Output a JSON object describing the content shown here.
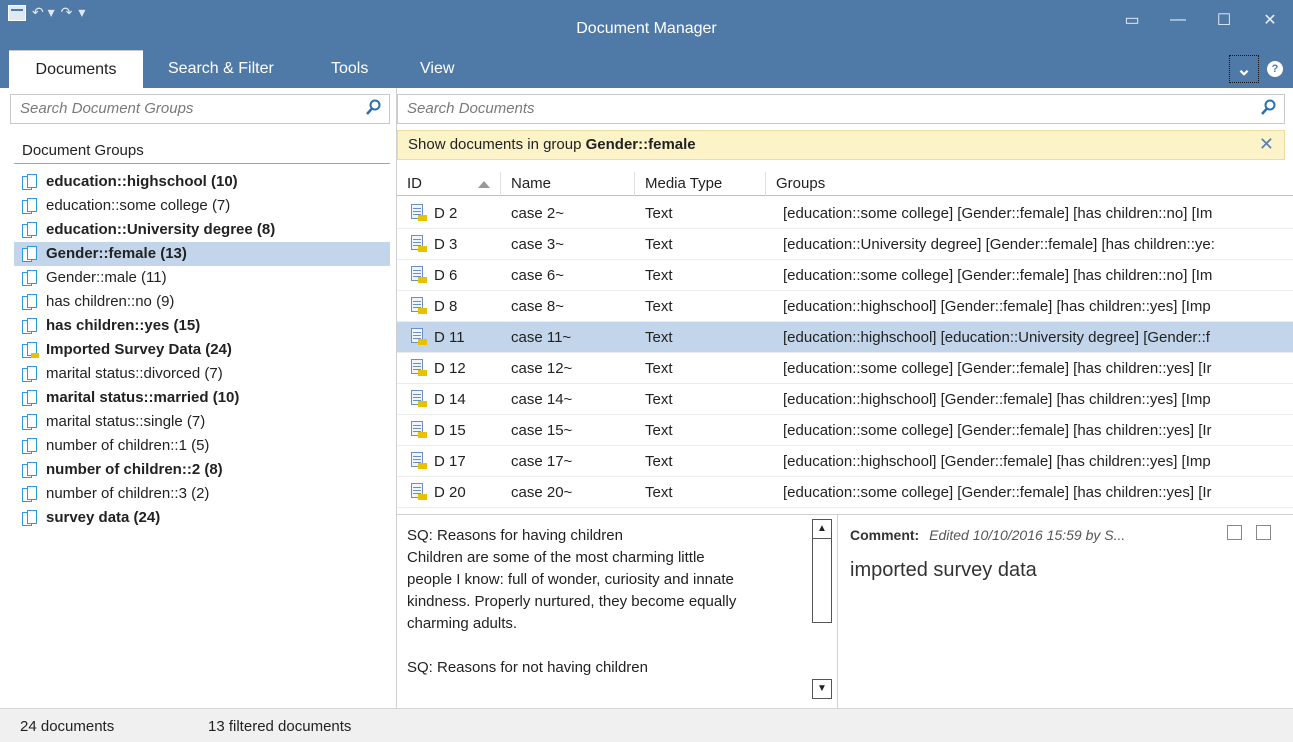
{
  "window": {
    "title": "Document Manager",
    "qat_undo": "↶ ▾",
    "qat_redo": "↷",
    "qat_customize": "▾",
    "restore_glyph": "▭",
    "minimize_glyph": "—",
    "maximize_glyph": "☐",
    "close_glyph": "✕"
  },
  "ribbon": {
    "tabs": [
      "Documents",
      "Search & Filter",
      "Tools",
      "View"
    ],
    "collapse_glyph": "⌄",
    "help_glyph": "?"
  },
  "left": {
    "search_placeholder": "Search Document Groups",
    "header": "Document Groups",
    "groups": [
      {
        "label": "education::highschool (10)",
        "bold": true,
        "selected": false,
        "tag": false
      },
      {
        "label": "education::some college (7)",
        "bold": false,
        "selected": false,
        "tag": false
      },
      {
        "label": "education::University degree (8)",
        "bold": true,
        "selected": false,
        "tag": false
      },
      {
        "label": "Gender::female (13)",
        "bold": true,
        "selected": true,
        "tag": false
      },
      {
        "label": "Gender::male (11)",
        "bold": false,
        "selected": false,
        "tag": false
      },
      {
        "label": "has children::no (9)",
        "bold": false,
        "selected": false,
        "tag": false
      },
      {
        "label": "has children::yes (15)",
        "bold": true,
        "selected": false,
        "tag": false
      },
      {
        "label": "Imported Survey Data (24)",
        "bold": true,
        "selected": false,
        "tag": true
      },
      {
        "label": "marital status::divorced (7)",
        "bold": false,
        "selected": false,
        "tag": false
      },
      {
        "label": "marital status::married (10)",
        "bold": true,
        "selected": false,
        "tag": false
      },
      {
        "label": "marital status::single (7)",
        "bold": false,
        "selected": false,
        "tag": false
      },
      {
        "label": "number of children::1 (5)",
        "bold": false,
        "selected": false,
        "tag": false
      },
      {
        "label": "number of children::2 (8)",
        "bold": true,
        "selected": false,
        "tag": false
      },
      {
        "label": "number of children::3 (2)",
        "bold": false,
        "selected": false,
        "tag": false
      },
      {
        "label": "survey data (24)",
        "bold": true,
        "selected": false,
        "tag": false
      }
    ]
  },
  "right": {
    "search_placeholder": "Search Documents",
    "filter_prefix": "Show documents in group ",
    "filter_group": "Gender::female",
    "filter_close": "✕",
    "columns": {
      "id": "ID",
      "name": "Name",
      "media": "Media Type",
      "groups": "Groups"
    },
    "rows": [
      {
        "id": "D 2",
        "name": "case 2~",
        "media": "Text",
        "groups": "[education::some college] [Gender::female] [has children::no] [Im",
        "selected": false
      },
      {
        "id": "D 3",
        "name": "case 3~",
        "media": "Text",
        "groups": "[education::University degree] [Gender::female] [has children::ye:",
        "selected": false
      },
      {
        "id": "D 6",
        "name": "case 6~",
        "media": "Text",
        "groups": "[education::some college] [Gender::female] [has children::no] [Im",
        "selected": false
      },
      {
        "id": "D 8",
        "name": "case 8~",
        "media": "Text",
        "groups": "[education::highschool] [Gender::female] [has children::yes] [Imp",
        "selected": false
      },
      {
        "id": "D 11",
        "name": "case 11~",
        "media": "Text",
        "groups": "[education::highschool] [education::University degree] [Gender::f",
        "selected": true
      },
      {
        "id": "D 12",
        "name": "case 12~",
        "media": "Text",
        "groups": "[education::some college] [Gender::female] [has children::yes] [Ir",
        "selected": false
      },
      {
        "id": "D 14",
        "name": "case 14~",
        "media": "Text",
        "groups": "[education::highschool] [Gender::female] [has children::yes] [Imp",
        "selected": false
      },
      {
        "id": "D 15",
        "name": "case 15~",
        "media": "Text",
        "groups": "[education::some college] [Gender::female] [has children::yes] [Ir",
        "selected": false
      },
      {
        "id": "D 17",
        "name": "case 17~",
        "media": "Text",
        "groups": "[education::highschool] [Gender::female] [has children::yes] [Imp",
        "selected": false
      },
      {
        "id": "D 20",
        "name": "case 20~",
        "media": "Text",
        "groups": "[education::some college] [Gender::female] [has children::yes] [Ir",
        "selected": false
      }
    ]
  },
  "preview": {
    "text": "SQ: Reasons for having children\nChildren are some of the most charming little\npeople I know: full of wonder, curiosity and innate\nkindness. Properly nurtured, they become equally\ncharming adults.\n\nSQ: Reasons for not having children",
    "scroll_up": "▲",
    "scroll_down": "▼"
  },
  "comment": {
    "label": "Comment:",
    "meta": "Edited 10/10/2016 15:59 by S...",
    "body": "imported survey data"
  },
  "status": {
    "documents": "24 documents",
    "filtered": "13 filtered documents"
  }
}
